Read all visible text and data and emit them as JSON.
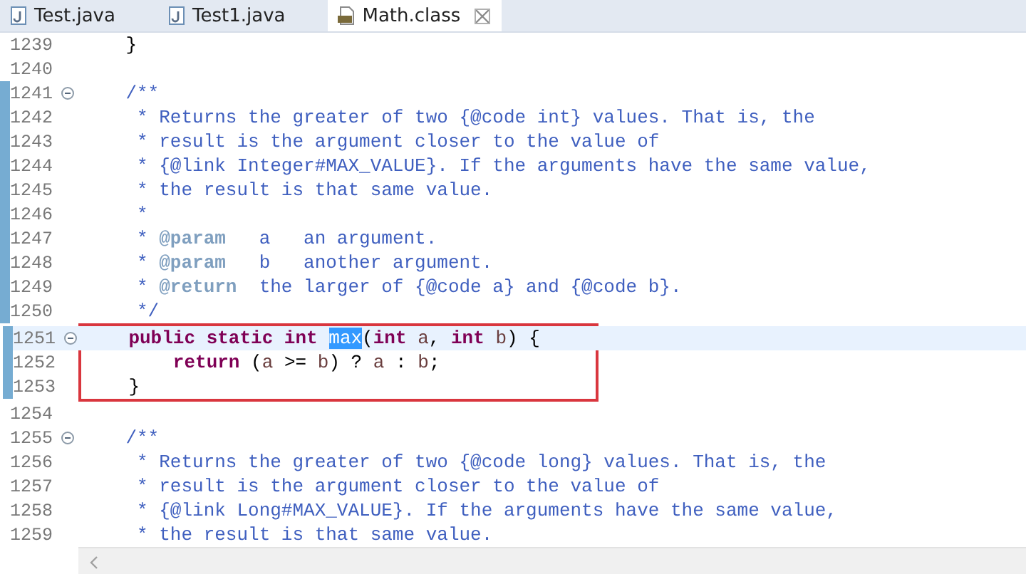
{
  "tabs": [
    {
      "label": "Test.java",
      "kind": "java",
      "selected": false,
      "closable": false
    },
    {
      "label": "Test1.java",
      "kind": "java",
      "selected": false,
      "closable": false
    },
    {
      "label": "Math.class",
      "kind": "class",
      "selected": true,
      "closable": true
    }
  ],
  "lines": [
    {
      "number": "1239",
      "fold": false,
      "changed": false,
      "current": false,
      "boxed": false,
      "tokens": [
        {
          "kind": "plain",
          "text": "    }"
        }
      ]
    },
    {
      "number": "1240",
      "fold": false,
      "changed": false,
      "current": false,
      "boxed": false
    },
    {
      "number": "1241",
      "fold": true,
      "changed": true,
      "current": false,
      "boxed": false,
      "tokens": [
        {
          "kind": "doc",
          "text": "    /**"
        }
      ]
    },
    {
      "number": "1242",
      "fold": false,
      "changed": true,
      "current": false,
      "boxed": false,
      "tokens": [
        {
          "kind": "doc",
          "text": "     * Returns the greater of two {@code int} values. That is, the"
        }
      ]
    },
    {
      "number": "1243",
      "fold": false,
      "changed": true,
      "current": false,
      "boxed": false,
      "tokens": [
        {
          "kind": "doc",
          "text": "     * result is the argument closer to the value of"
        }
      ]
    },
    {
      "number": "1244",
      "fold": false,
      "changed": true,
      "current": false,
      "boxed": false,
      "tokens": [
        {
          "kind": "doc",
          "text": "     * {@link Integer#MAX_VALUE}. If the arguments have the same value,"
        }
      ]
    },
    {
      "number": "1245",
      "fold": false,
      "changed": true,
      "current": false,
      "boxed": false,
      "tokens": [
        {
          "kind": "doc",
          "text": "     * the result is that same value."
        }
      ]
    },
    {
      "number": "1246",
      "fold": false,
      "changed": true,
      "current": false,
      "boxed": false,
      "tokens": [
        {
          "kind": "doc",
          "text": "     *"
        }
      ]
    },
    {
      "number": "1247",
      "fold": false,
      "changed": true,
      "current": false,
      "boxed": false,
      "tokens": [
        {
          "kind": "doc",
          "text": "     * "
        },
        {
          "kind": "tag",
          "text": "@param"
        },
        {
          "kind": "doc",
          "text": "   a   an argument."
        }
      ]
    },
    {
      "number": "1248",
      "fold": false,
      "changed": true,
      "current": false,
      "boxed": false,
      "tokens": [
        {
          "kind": "doc",
          "text": "     * "
        },
        {
          "kind": "tag",
          "text": "@param"
        },
        {
          "kind": "doc",
          "text": "   b   another argument."
        }
      ]
    },
    {
      "number": "1249",
      "fold": false,
      "changed": true,
      "current": false,
      "boxed": false,
      "tokens": [
        {
          "kind": "doc",
          "text": "     * "
        },
        {
          "kind": "tag",
          "text": "@return"
        },
        {
          "kind": "doc",
          "text": "  the larger of {@code a} and {@code b}."
        }
      ]
    },
    {
      "number": "1250",
      "fold": false,
      "changed": true,
      "current": false,
      "boxed": false,
      "tokens": [
        {
          "kind": "doc",
          "text": "     */"
        }
      ]
    },
    {
      "number": "1251",
      "fold": true,
      "changed": true,
      "current": true,
      "boxed": true,
      "tokens": [
        {
          "kind": "keyword",
          "text": "    public static int "
        },
        {
          "kind": "selection",
          "text": "max"
        },
        {
          "kind": "plain",
          "text": "("
        },
        {
          "kind": "keyword",
          "text": "int "
        },
        {
          "kind": "variable",
          "text": "a"
        },
        {
          "kind": "plain",
          "text": ", "
        },
        {
          "kind": "keyword",
          "text": "int "
        },
        {
          "kind": "variable",
          "text": "b"
        },
        {
          "kind": "plain",
          "text": ") {"
        }
      ]
    },
    {
      "number": "1252",
      "fold": false,
      "changed": true,
      "current": false,
      "boxed": true,
      "tokens": [
        {
          "kind": "keyword",
          "text": "        return "
        },
        {
          "kind": "plain",
          "text": "("
        },
        {
          "kind": "variable",
          "text": "a"
        },
        {
          "kind": "plain",
          "text": " >= "
        },
        {
          "kind": "variable",
          "text": "b"
        },
        {
          "kind": "plain",
          "text": ") ? "
        },
        {
          "kind": "variable",
          "text": "a"
        },
        {
          "kind": "plain",
          "text": " : "
        },
        {
          "kind": "variable",
          "text": "b"
        },
        {
          "kind": "plain",
          "text": ";"
        }
      ]
    },
    {
      "number": "1253",
      "fold": false,
      "changed": true,
      "current": false,
      "boxed": true,
      "tokens": [
        {
          "kind": "plain",
          "text": "    }"
        }
      ]
    },
    {
      "number": "1254",
      "fold": false,
      "changed": false,
      "current": false,
      "boxed": false
    },
    {
      "number": "1255",
      "fold": true,
      "changed": false,
      "current": false,
      "boxed": false,
      "tokens": [
        {
          "kind": "doc",
          "text": "    /**"
        }
      ]
    },
    {
      "number": "1256",
      "fold": false,
      "changed": false,
      "current": false,
      "boxed": false,
      "tokens": [
        {
          "kind": "doc",
          "text": "     * Returns the greater of two {@code long} values. That is, the"
        }
      ]
    },
    {
      "number": "1257",
      "fold": false,
      "changed": false,
      "current": false,
      "boxed": false,
      "tokens": [
        {
          "kind": "doc",
          "text": "     * result is the argument closer to the value of"
        }
      ]
    },
    {
      "number": "1258",
      "fold": false,
      "changed": false,
      "current": false,
      "boxed": false,
      "tokens": [
        {
          "kind": "doc",
          "text": "     * {@link Long#MAX_VALUE}. If the arguments have the same value,"
        }
      ]
    },
    {
      "number": "1259",
      "fold": false,
      "changed": false,
      "current": false,
      "boxed": false,
      "tokens": [
        {
          "kind": "doc",
          "text": "     * the result is that same value."
        }
      ]
    }
  ]
}
